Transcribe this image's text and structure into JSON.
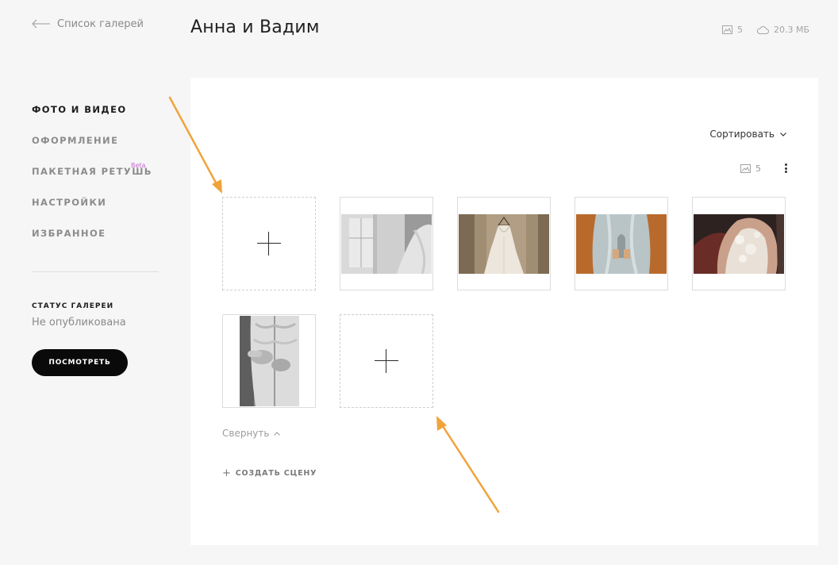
{
  "header": {
    "back_label": "Список галерей",
    "title": "Анна и Вадим",
    "photo_count": "5",
    "storage_size": "20.3 МБ"
  },
  "sidebar": {
    "items": [
      {
        "label": "ФОТО И ВИДЕО",
        "active": true
      },
      {
        "label": "ОФОРМЛЕНИЕ",
        "active": false
      },
      {
        "label": "ПАКЕТНАЯ РЕТУШЬ",
        "active": false,
        "badge": "Beta"
      },
      {
        "label": "НАСТРОЙКИ",
        "active": false
      },
      {
        "label": "ИЗБРАННОЕ",
        "active": false
      }
    ],
    "status_label": "СТАТУС ГАЛЕРЕИ",
    "status_value": "Не опубликована",
    "view_button_label": "ПОСМОТРЕТЬ"
  },
  "main": {
    "sort_label": "Сортировать",
    "scene_photo_count": "5",
    "collapse_label": "Свернуть",
    "create_scene_label": "СОЗДАТЬ СЦЕНУ",
    "photos": [
      {
        "name": "photo-window-bride",
        "orientation": "landscape"
      },
      {
        "name": "photo-wedding-dress-hanger",
        "orientation": "landscape"
      },
      {
        "name": "photo-dress-veil",
        "orientation": "landscape"
      },
      {
        "name": "photo-lace-back",
        "orientation": "landscape"
      },
      {
        "name": "photo-buttoning-dress",
        "orientation": "portrait"
      }
    ]
  },
  "colors": {
    "page_background": "#f6f6f6",
    "panel_background": "#ffffff",
    "annotation_arrow": "#f0a33a",
    "beta_badge": "#c46bd1",
    "button_background": "#0a0a0a"
  }
}
